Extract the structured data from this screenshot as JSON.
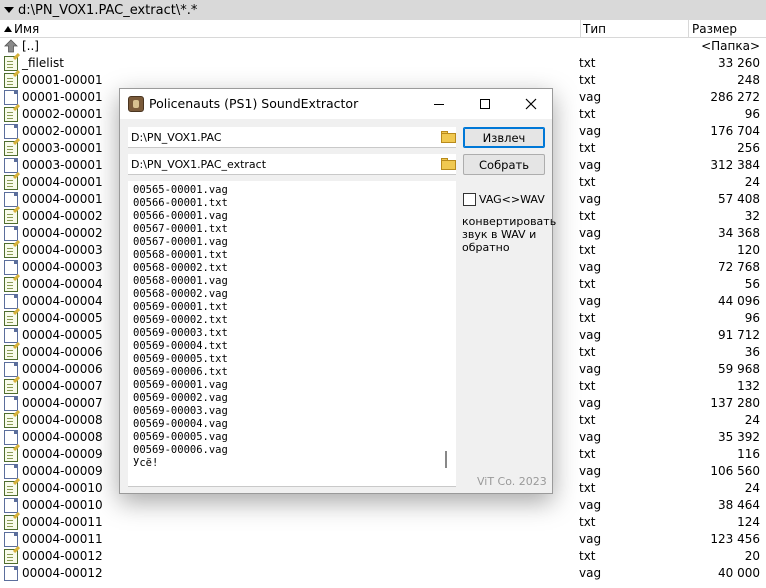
{
  "fm": {
    "path": "d:\\PN_VOX1.PAC_extract\\*.*",
    "columns": {
      "name": "Имя",
      "type": "Тип",
      "size": "Размер"
    },
    "rows": [
      {
        "icon": "folder-up-icon",
        "name": "[..]",
        "type": "",
        "size": "<Папка>"
      },
      {
        "icon": "text-file-icon",
        "name": "_filelist",
        "type": "txt",
        "size": "33 260"
      },
      {
        "icon": "text-file-icon",
        "name": "00001-00001",
        "type": "txt",
        "size": "248"
      },
      {
        "icon": "audio-file-icon",
        "name": "00001-00001",
        "type": "vag",
        "size": "286 272"
      },
      {
        "icon": "text-file-icon",
        "name": "00002-00001",
        "type": "txt",
        "size": "96"
      },
      {
        "icon": "audio-file-icon",
        "name": "00002-00001",
        "type": "vag",
        "size": "176 704"
      },
      {
        "icon": "text-file-icon",
        "name": "00003-00001",
        "type": "txt",
        "size": "256"
      },
      {
        "icon": "audio-file-icon",
        "name": "00003-00001",
        "type": "vag",
        "size": "312 384"
      },
      {
        "icon": "text-file-icon",
        "name": "00004-00001",
        "type": "txt",
        "size": "24"
      },
      {
        "icon": "audio-file-icon",
        "name": "00004-00001",
        "type": "vag",
        "size": "57 408"
      },
      {
        "icon": "text-file-icon",
        "name": "00004-00002",
        "type": "txt",
        "size": "32"
      },
      {
        "icon": "audio-file-icon",
        "name": "00004-00002",
        "type": "vag",
        "size": "34 368"
      },
      {
        "icon": "text-file-icon",
        "name": "00004-00003",
        "type": "txt",
        "size": "120"
      },
      {
        "icon": "audio-file-icon",
        "name": "00004-00003",
        "type": "vag",
        "size": "72 768"
      },
      {
        "icon": "text-file-icon",
        "name": "00004-00004",
        "type": "txt",
        "size": "56"
      },
      {
        "icon": "audio-file-icon",
        "name": "00004-00004",
        "type": "vag",
        "size": "44 096"
      },
      {
        "icon": "text-file-icon",
        "name": "00004-00005",
        "type": "txt",
        "size": "96"
      },
      {
        "icon": "audio-file-icon",
        "name": "00004-00005",
        "type": "vag",
        "size": "91 712"
      },
      {
        "icon": "text-file-icon",
        "name": "00004-00006",
        "type": "txt",
        "size": "36"
      },
      {
        "icon": "audio-file-icon",
        "name": "00004-00006",
        "type": "vag",
        "size": "59 968"
      },
      {
        "icon": "text-file-icon",
        "name": "00004-00007",
        "type": "txt",
        "size": "132"
      },
      {
        "icon": "audio-file-icon",
        "name": "00004-00007",
        "type": "vag",
        "size": "137 280"
      },
      {
        "icon": "text-file-icon",
        "name": "00004-00008",
        "type": "txt",
        "size": "24"
      },
      {
        "icon": "audio-file-icon",
        "name": "00004-00008",
        "type": "vag",
        "size": "35 392"
      },
      {
        "icon": "text-file-icon",
        "name": "00004-00009",
        "type": "txt",
        "size": "116"
      },
      {
        "icon": "audio-file-icon",
        "name": "00004-00009",
        "type": "vag",
        "size": "106 560"
      },
      {
        "icon": "text-file-icon",
        "name": "00004-00010",
        "type": "txt",
        "size": "24"
      },
      {
        "icon": "audio-file-icon",
        "name": "00004-00010",
        "type": "vag",
        "size": "38 464"
      },
      {
        "icon": "text-file-icon",
        "name": "00004-00011",
        "type": "txt",
        "size": "124"
      },
      {
        "icon": "audio-file-icon",
        "name": "00004-00011",
        "type": "vag",
        "size": "123 456"
      },
      {
        "icon": "text-file-icon",
        "name": "00004-00012",
        "type": "txt",
        "size": "20"
      },
      {
        "icon": "audio-file-icon",
        "name": "00004-00012",
        "type": "vag",
        "size": "40 000"
      }
    ]
  },
  "dialog": {
    "title": "Policenauts (PS1) SoundExtractor",
    "source_path": "D:\\PN_VOX1.PAC",
    "target_path": "D:\\PN_VOX1.PAC_extract",
    "extract_label": "Извлеч",
    "build_label": "Собрать",
    "log": [
      "00565-00001.vag",
      "00566-00001.txt",
      "00566-00001.vag",
      "00567-00001.txt",
      "00567-00001.vag",
      "00568-00001.txt",
      "00568-00002.txt",
      "00568-00001.vag",
      "00568-00002.vag",
      "00569-00001.txt",
      "00569-00002.txt",
      "00569-00003.txt",
      "00569-00004.txt",
      "00569-00005.txt",
      "00569-00006.txt",
      "00569-00001.vag",
      "00569-00002.vag",
      "00569-00003.vag",
      "00569-00004.vag",
      "00569-00005.vag",
      "00569-00006.vag",
      "Усё!"
    ],
    "convert_checkbox_label": "VAG<>WAV",
    "convert_checked": false,
    "convert_hint": "конвертировать звук в WAV и обратно",
    "brand": "ViT Co. 2023"
  }
}
